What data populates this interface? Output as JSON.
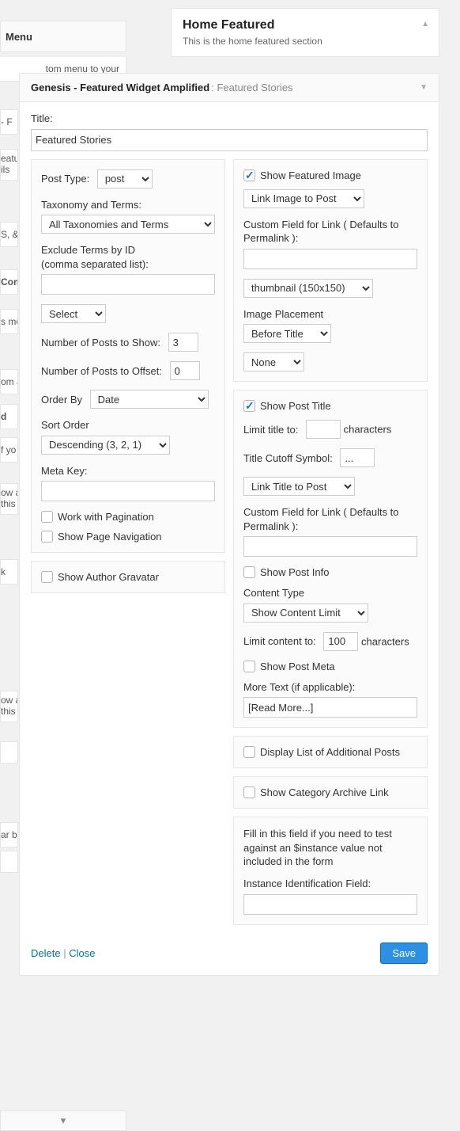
{
  "menu_label": "Menu",
  "left_fragments": [
    "tom menu to your",
    " - F",
    "eatu",
    "ils",
    "S, &",
    "Com",
    "s me",
    "om a",
    "d",
    "f yo",
    "ow a",
    "this",
    "k",
    "ow a",
    "this",
    "ar b"
  ],
  "hf": {
    "title": "Home Featured",
    "desc": "This is the home featured section"
  },
  "widget": {
    "name": "Genesis - Featured Widget Amplified",
    "sub": ": Featured Stories",
    "title_label": "Title:",
    "title_value": "Featured Stories"
  },
  "left": {
    "post_type_label": "Post Type:",
    "post_type_value": "post",
    "taxonomy_label": "Taxonomy and Terms:",
    "taxonomy_value": "All Taxonomies and Terms",
    "exclude_label": "Exclude Terms by ID",
    "exclude_sub": "(comma separated list):",
    "exclude_value": "",
    "select_value": "Select",
    "num_show_label": "Number of Posts to Show:",
    "num_show_value": "3",
    "num_offset_label": "Number of Posts to Offset:",
    "num_offset_value": "0",
    "order_by_label": "Order By",
    "order_by_value": "Date",
    "sort_order_label": "Sort Order",
    "sort_order_value": "Descending (3, 2, 1)",
    "meta_key_label": "Meta Key:",
    "meta_key_value": "",
    "pagination_label": "Work with Pagination",
    "page_nav_label": "Show Page Navigation",
    "gravatar_label": "Show Author Gravatar"
  },
  "right": {
    "show_image_label": "Show Featured Image",
    "link_image_value": "Link Image to Post",
    "custom_field_link_label": "Custom Field for Link ( Defaults to Permalink ):",
    "custom_field_link_value": "",
    "image_size_value": "thumbnail (150x150)",
    "image_placement_label": "Image Placement",
    "image_placement_value": "Before Title",
    "none_value": "None",
    "show_title_label": "Show Post Title",
    "limit_title_label": "Limit title to:",
    "limit_title_value": "",
    "characters": "characters",
    "cutoff_label": "Title Cutoff Symbol:",
    "cutoff_value": "...",
    "link_title_value": "Link Title to Post",
    "custom_field_link2_label": "Custom Field for Link ( Defaults to Permalink ):",
    "custom_field_link2_value": "",
    "show_post_info_label": "Show Post Info",
    "content_type_label": "Content Type",
    "content_type_value": "Show Content Limit",
    "limit_content_label": "Limit content to:",
    "limit_content_value": "100",
    "show_post_meta_label": "Show Post Meta",
    "more_text_label": "More Text (if applicable):",
    "more_text_value": "[Read More...]",
    "additional_posts_label": "Display List of Additional Posts",
    "show_archive_label": "Show Category Archive Link",
    "instance_hint": "Fill in this field if you need to test against an $instance value not included in the form",
    "instance_label": "Instance Identification Field:",
    "instance_value": ""
  },
  "footer": {
    "delete": "Delete",
    "close": "Close",
    "save": "Save"
  }
}
